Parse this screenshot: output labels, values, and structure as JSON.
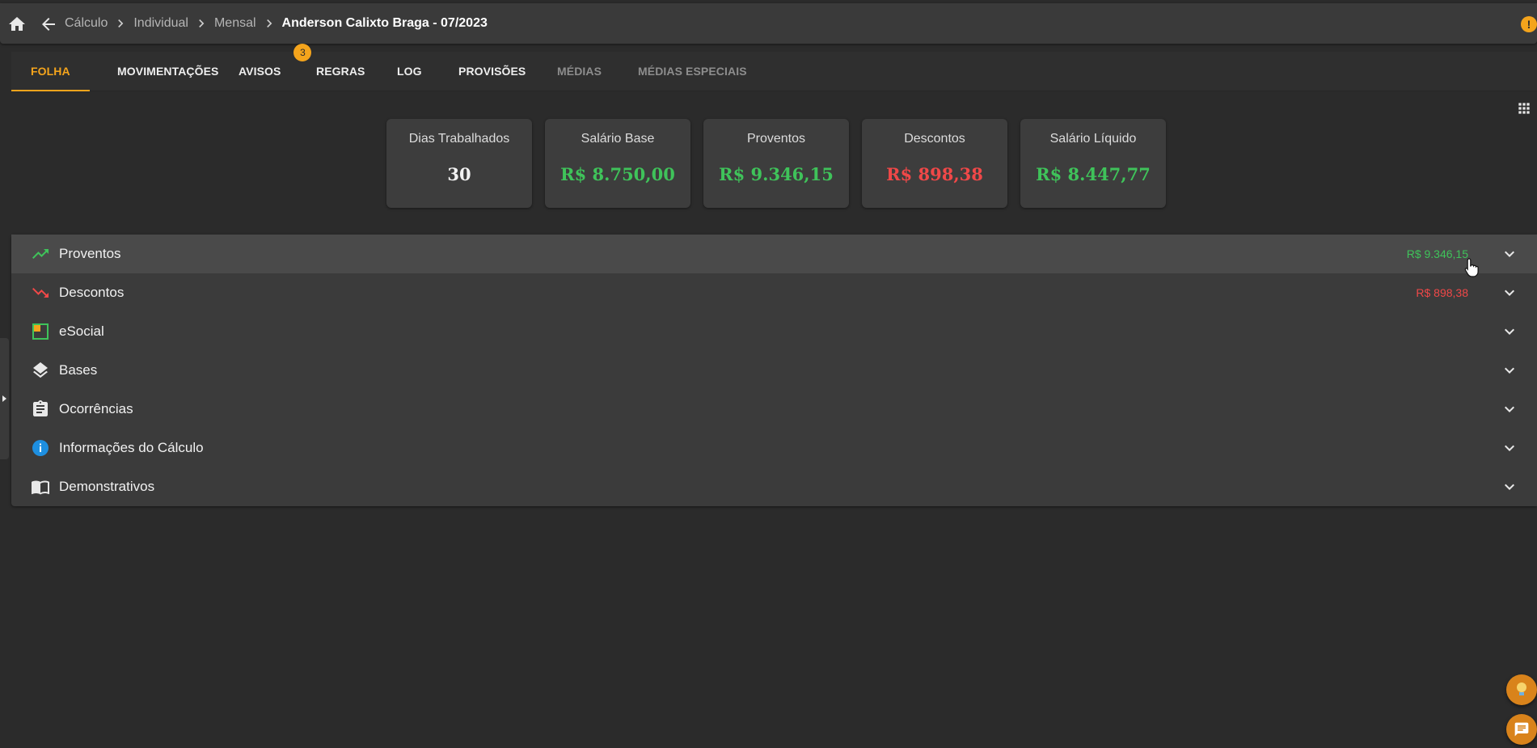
{
  "breadcrumb": [
    "Cálculo",
    "Individual",
    "Mensal"
  ],
  "breadcrumb_current": "Anderson Calixto Braga - 07/2023",
  "tabs": {
    "folha": "FOLHA",
    "movimentacoes": "MOVIMENTAÇÕES",
    "avisos": "AVISOS",
    "avisos_badge": "3",
    "regras": "REGRAS",
    "log": "LOG",
    "provisoes": "PROVISÕES",
    "medias": "MÉDIAS",
    "medias_especiais": "MÉDIAS ESPECIAIS"
  },
  "warning_badge": "!",
  "cards": [
    {
      "label": "Dias Trabalhados",
      "value": "30"
    },
    {
      "label": "Salário Base",
      "value": "R$ 8.750,00"
    },
    {
      "label": "Proventos",
      "value": "R$ 9.346,15"
    },
    {
      "label": "Descontos",
      "value": "R$ 898,38"
    },
    {
      "label": "Salário Líquido",
      "value": "R$ 8.447,77"
    }
  ],
  "sections": [
    {
      "label": "Proventos",
      "amount": "R$ 9.346,15",
      "icon": "trending-up-icon"
    },
    {
      "label": "Descontos",
      "amount": "R$ 898,38",
      "icon": "trending-down-icon"
    },
    {
      "label": "eSocial",
      "icon": "esocial-icon"
    },
    {
      "label": "Bases",
      "icon": "layers-icon"
    },
    {
      "label": "Ocorrências",
      "icon": "clipboard-icon"
    },
    {
      "label": "Informações do Cálculo",
      "icon": "info-icon"
    },
    {
      "label": "Demonstrativos",
      "icon": "book-icon"
    }
  ],
  "colors": {
    "accent": "#f4a41c",
    "positive": "#3fc35a",
    "negative": "#f04848",
    "background": "#2b2b2b"
  }
}
